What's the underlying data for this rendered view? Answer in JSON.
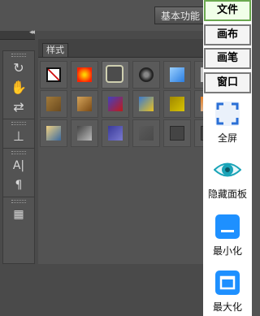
{
  "workspace_label": "基本功能",
  "panel": {
    "tab": "样式"
  },
  "tools": [
    "↻",
    "✋",
    "⇄",
    "⊥",
    "A|",
    "¶",
    "▦"
  ],
  "styles": [
    {
      "bg": "#ffffff",
      "fg": "#d01010",
      "kind": "none"
    },
    {
      "bg": "#ff2200",
      "fg": "#ffd000",
      "kind": "glow"
    },
    {
      "bg": "#4c4c4c",
      "fg": "#cfcfb0",
      "kind": "sel"
    },
    {
      "bg": "#222222",
      "fg": "#888888",
      "kind": "round"
    },
    {
      "bg": "#2a7de0",
      "fg": "#9ad0ff",
      "kind": "flat"
    },
    {
      "bg": "#c7c7c7",
      "fg": "#c7c7c7",
      "kind": "flat"
    },
    {
      "bg": "#6b4a1e",
      "fg": "#a27a3a",
      "kind": "flat"
    },
    {
      "bg": "#7a4a14",
      "fg": "#d4a35a",
      "kind": "flat"
    },
    {
      "bg": "#c01a1a",
      "fg": "#4040c0",
      "kind": "flat"
    },
    {
      "bg": "#e8c020",
      "fg": "#3a7ad0",
      "kind": "flat"
    },
    {
      "bg": "#d8c400",
      "fg": "#a08800",
      "kind": "flat"
    },
    {
      "bg": "#e0e0e0",
      "fg": "#e07a20",
      "kind": "flat"
    },
    {
      "bg": "#3a6aa0",
      "fg": "#f0d080",
      "kind": "flat"
    },
    {
      "bg": "#bbbbbb",
      "fg": "#444444",
      "kind": "flat"
    },
    {
      "bg": "#7a7ad0",
      "fg": "#3a3a9a",
      "kind": "flat"
    },
    {
      "bg": "#4a4a4a",
      "fg": "#5a5a5a",
      "kind": "flat"
    },
    {
      "bg": "#444444",
      "fg": "#2a2a2a",
      "kind": "outline"
    },
    {
      "bg": "#444444",
      "fg": "#2a2a2a",
      "kind": "outline"
    }
  ],
  "menu": [
    {
      "label": "文件",
      "active": true
    },
    {
      "label": "画布",
      "active": false
    },
    {
      "label": "画笔",
      "active": false
    },
    {
      "label": "窗口",
      "active": false
    }
  ],
  "actions": [
    {
      "label": "全屏",
      "icon": "fullscreen-icon",
      "color": "#2a6fd6"
    },
    {
      "label": "隐藏面板",
      "icon": "eye-icon",
      "color": "#1aa4b8"
    },
    {
      "label": "最小化",
      "icon": "minimize-icon",
      "color": "#1e90ff"
    },
    {
      "label": "最大化",
      "icon": "maximize-icon",
      "color": "#1e90ff"
    }
  ]
}
